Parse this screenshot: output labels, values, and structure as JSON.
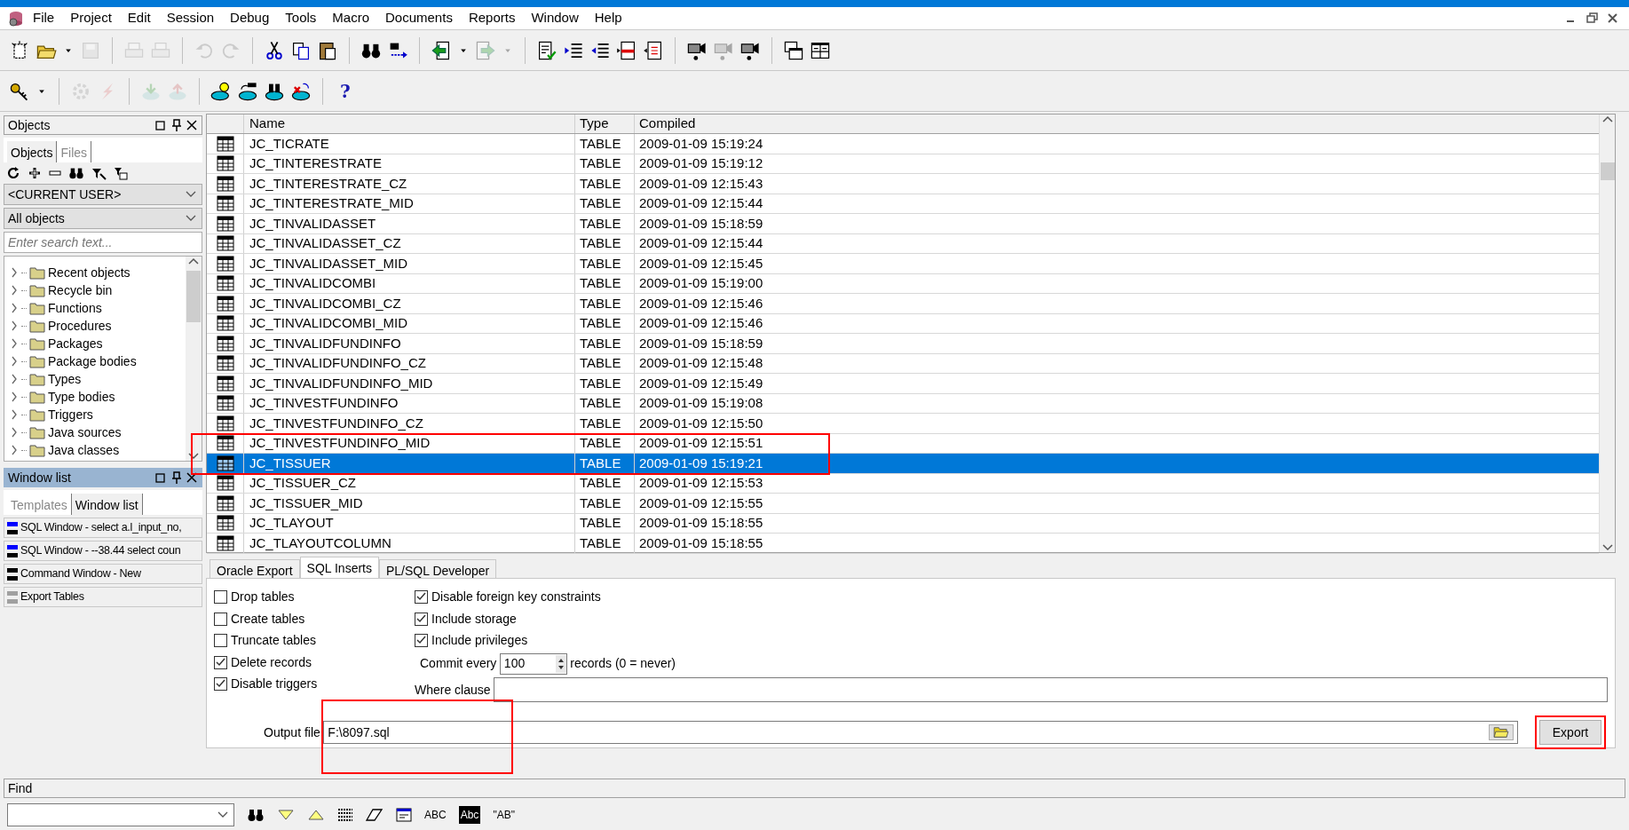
{
  "menu": [
    "File",
    "Project",
    "Edit",
    "Session",
    "Debug",
    "Tools",
    "Macro",
    "Documents",
    "Reports",
    "Window",
    "Help"
  ],
  "toolbar_1": [
    {
      "disabled": false
    },
    {
      "disabled": false
    },
    {
      "disabled": false
    },
    {
      "disabled": true
    },
    {
      "disabled": true
    },
    {
      "disabled": true
    },
    {
      "disabled": true
    },
    {
      "disabled": true
    },
    {
      "disabled": false
    },
    {
      "disabled": false
    },
    {
      "disabled": false
    },
    {
      "disabled": false
    },
    {
      "disabled": false
    },
    {
      "disabled": false
    },
    {
      "disabled": false
    },
    {
      "disabled": true
    },
    {
      "disabled": true
    },
    {
      "disabled": false
    },
    {
      "disabled": false
    },
    {
      "disabled": false
    },
    {
      "disabled": false
    },
    {
      "disabled": false
    },
    {
      "disabled": false
    },
    {
      "disabled": true
    },
    {
      "disabled": false
    },
    {
      "disabled": false
    },
    {
      "disabled": false
    }
  ],
  "toolbar_2": [
    {
      "disabled": false
    },
    {
      "disabled": false
    },
    {
      "disabled": true
    },
    {
      "disabled": true
    },
    {
      "disabled": true
    },
    {
      "disabled": true
    },
    {
      "disabled": false
    },
    {
      "disabled": false
    },
    {
      "disabled": false
    },
    {
      "disabled": false
    }
  ],
  "help_button": {
    "text": "?"
  },
  "objects_panel": {
    "title": "Objects",
    "tabs": [
      {
        "label": "Objects",
        "selected": true
      },
      {
        "label": "Files",
        "selected": false
      }
    ],
    "user_select": "<CURRENT USER>",
    "filter_select": "All objects",
    "search": {
      "placeholder": "Enter search text..."
    },
    "tree": [
      {
        "label": "Recent objects",
        "expanded": false
      },
      {
        "label": "Recycle bin",
        "expanded": false
      },
      {
        "label": "Functions",
        "expanded": false
      },
      {
        "label": "Procedures",
        "expanded": false
      },
      {
        "label": "Packages",
        "expanded": false
      },
      {
        "label": "Package bodies",
        "expanded": false
      },
      {
        "label": "Types",
        "expanded": false
      },
      {
        "label": "Type bodies",
        "expanded": false
      },
      {
        "label": "Triggers",
        "expanded": false
      },
      {
        "label": "Java sources",
        "expanded": false
      },
      {
        "label": "Java classes",
        "expanded": false
      }
    ]
  },
  "window_list_panel": {
    "title": "Window list",
    "tabs": [
      {
        "label": "Templates",
        "selected": false
      },
      {
        "label": "Window list",
        "selected": true
      }
    ],
    "items": [
      {
        "label": "SQL Window - select a.l_input_no,",
        "color": "#0000ff"
      },
      {
        "label": "SQL Window - --38.44 select coun",
        "color": "#0000ff"
      },
      {
        "label": "Command Window - New",
        "color": "#000000"
      },
      {
        "label": "Export Tables",
        "color": "#a0a0a0"
      }
    ]
  },
  "table": {
    "columns": [
      "Name",
      "Type",
      "Compiled"
    ],
    "rows": [
      {
        "name": "JC_TICRATE",
        "type": "TABLE",
        "compiled": "2009-01-09 15:19:24",
        "selected": false,
        "marked": false
      },
      {
        "name": "JC_TINTERESTRATE",
        "type": "TABLE",
        "compiled": "2009-01-09 15:19:12",
        "selected": false,
        "marked": false
      },
      {
        "name": "JC_TINTERESTRATE_CZ",
        "type": "TABLE",
        "compiled": "2009-01-09 12:15:43",
        "selected": false,
        "marked": false
      },
      {
        "name": "JC_TINTERESTRATE_MID",
        "type": "TABLE",
        "compiled": "2009-01-09 12:15:44",
        "selected": false,
        "marked": false
      },
      {
        "name": "JC_TINVALIDASSET",
        "type": "TABLE",
        "compiled": "2009-01-09 15:18:59",
        "selected": false,
        "marked": false
      },
      {
        "name": "JC_TINVALIDASSET_CZ",
        "type": "TABLE",
        "compiled": "2009-01-09 12:15:44",
        "selected": false,
        "marked": false
      },
      {
        "name": "JC_TINVALIDASSET_MID",
        "type": "TABLE",
        "compiled": "2009-01-09 12:15:45",
        "selected": false,
        "marked": false
      },
      {
        "name": "JC_TINVALIDCOMBI",
        "type": "TABLE",
        "compiled": "2009-01-09 15:19:00",
        "selected": false,
        "marked": false
      },
      {
        "name": "JC_TINVALIDCOMBI_CZ",
        "type": "TABLE",
        "compiled": "2009-01-09 12:15:46",
        "selected": false,
        "marked": false
      },
      {
        "name": "JC_TINVALIDCOMBI_MID",
        "type": "TABLE",
        "compiled": "2009-01-09 12:15:46",
        "selected": false,
        "marked": false
      },
      {
        "name": "JC_TINVALIDFUNDINFO",
        "type": "TABLE",
        "compiled": "2009-01-09 15:18:59",
        "selected": false,
        "marked": false
      },
      {
        "name": "JC_TINVALIDFUNDINFO_CZ",
        "type": "TABLE",
        "compiled": "2009-01-09 12:15:48",
        "selected": false,
        "marked": false
      },
      {
        "name": "JC_TINVALIDFUNDINFO_MID",
        "type": "TABLE",
        "compiled": "2009-01-09 12:15:49",
        "selected": false,
        "marked": false
      },
      {
        "name": "JC_TINVESTFUNDINFO",
        "type": "TABLE",
        "compiled": "2009-01-09 15:19:08",
        "selected": false,
        "marked": false
      },
      {
        "name": "JC_TINVESTFUNDINFO_CZ",
        "type": "TABLE",
        "compiled": "2009-01-09 12:15:50",
        "selected": false,
        "marked": false
      },
      {
        "name": "JC_TINVESTFUNDINFO_MID",
        "type": "TABLE",
        "compiled": "2009-01-09 12:15:51",
        "selected": false,
        "marked": true
      },
      {
        "name": "JC_TISSUER",
        "type": "TABLE",
        "compiled": "2009-01-09 15:19:21",
        "selected": true,
        "marked": true
      },
      {
        "name": "JC_TISSUER_CZ",
        "type": "TABLE",
        "compiled": "2009-01-09 12:15:53",
        "selected": false,
        "marked": false
      },
      {
        "name": "JC_TISSUER_MID",
        "type": "TABLE",
        "compiled": "2009-01-09 12:15:55",
        "selected": false,
        "marked": false
      },
      {
        "name": "JC_TLAYOUT",
        "type": "TABLE",
        "compiled": "2009-01-09 15:18:55",
        "selected": false,
        "marked": false
      },
      {
        "name": "JC_TLAYOUTCOLUMN",
        "type": "TABLE",
        "compiled": "2009-01-09 15:18:55",
        "selected": false,
        "marked": false
      }
    ]
  },
  "export_tabs": [
    {
      "label": "Oracle Export",
      "selected": false
    },
    {
      "label": "SQL Inserts",
      "selected": true
    },
    {
      "label": "PL/SQL Developer",
      "selected": false
    }
  ],
  "options": {
    "left": [
      {
        "label": "Drop tables",
        "checked": false
      },
      {
        "label": "Create tables",
        "checked": false
      },
      {
        "label": "Truncate tables",
        "checked": false
      },
      {
        "label": "Delete records",
        "checked": true
      },
      {
        "label": "Disable triggers",
        "checked": true
      }
    ],
    "right": [
      {
        "label": "Disable foreign key constraints",
        "checked": true
      },
      {
        "label": "Include storage",
        "checked": true
      },
      {
        "label": "Include privileges",
        "checked": true
      }
    ],
    "commit_label": "Commit every",
    "commit_value": "100",
    "commit_suffix": "records (0 = never)",
    "where_label": "Where clause",
    "output_label": "Output file",
    "output_value": "F:\\8097.sql",
    "output_marked": true
  },
  "export_button": {
    "label": "Export",
    "marked": true
  },
  "find_panel": {
    "title": "Find",
    "buttons": [
      {
        "text": "ABC"
      },
      {
        "text": "Abc"
      },
      {
        "text": "\"AB\""
      }
    ]
  }
}
